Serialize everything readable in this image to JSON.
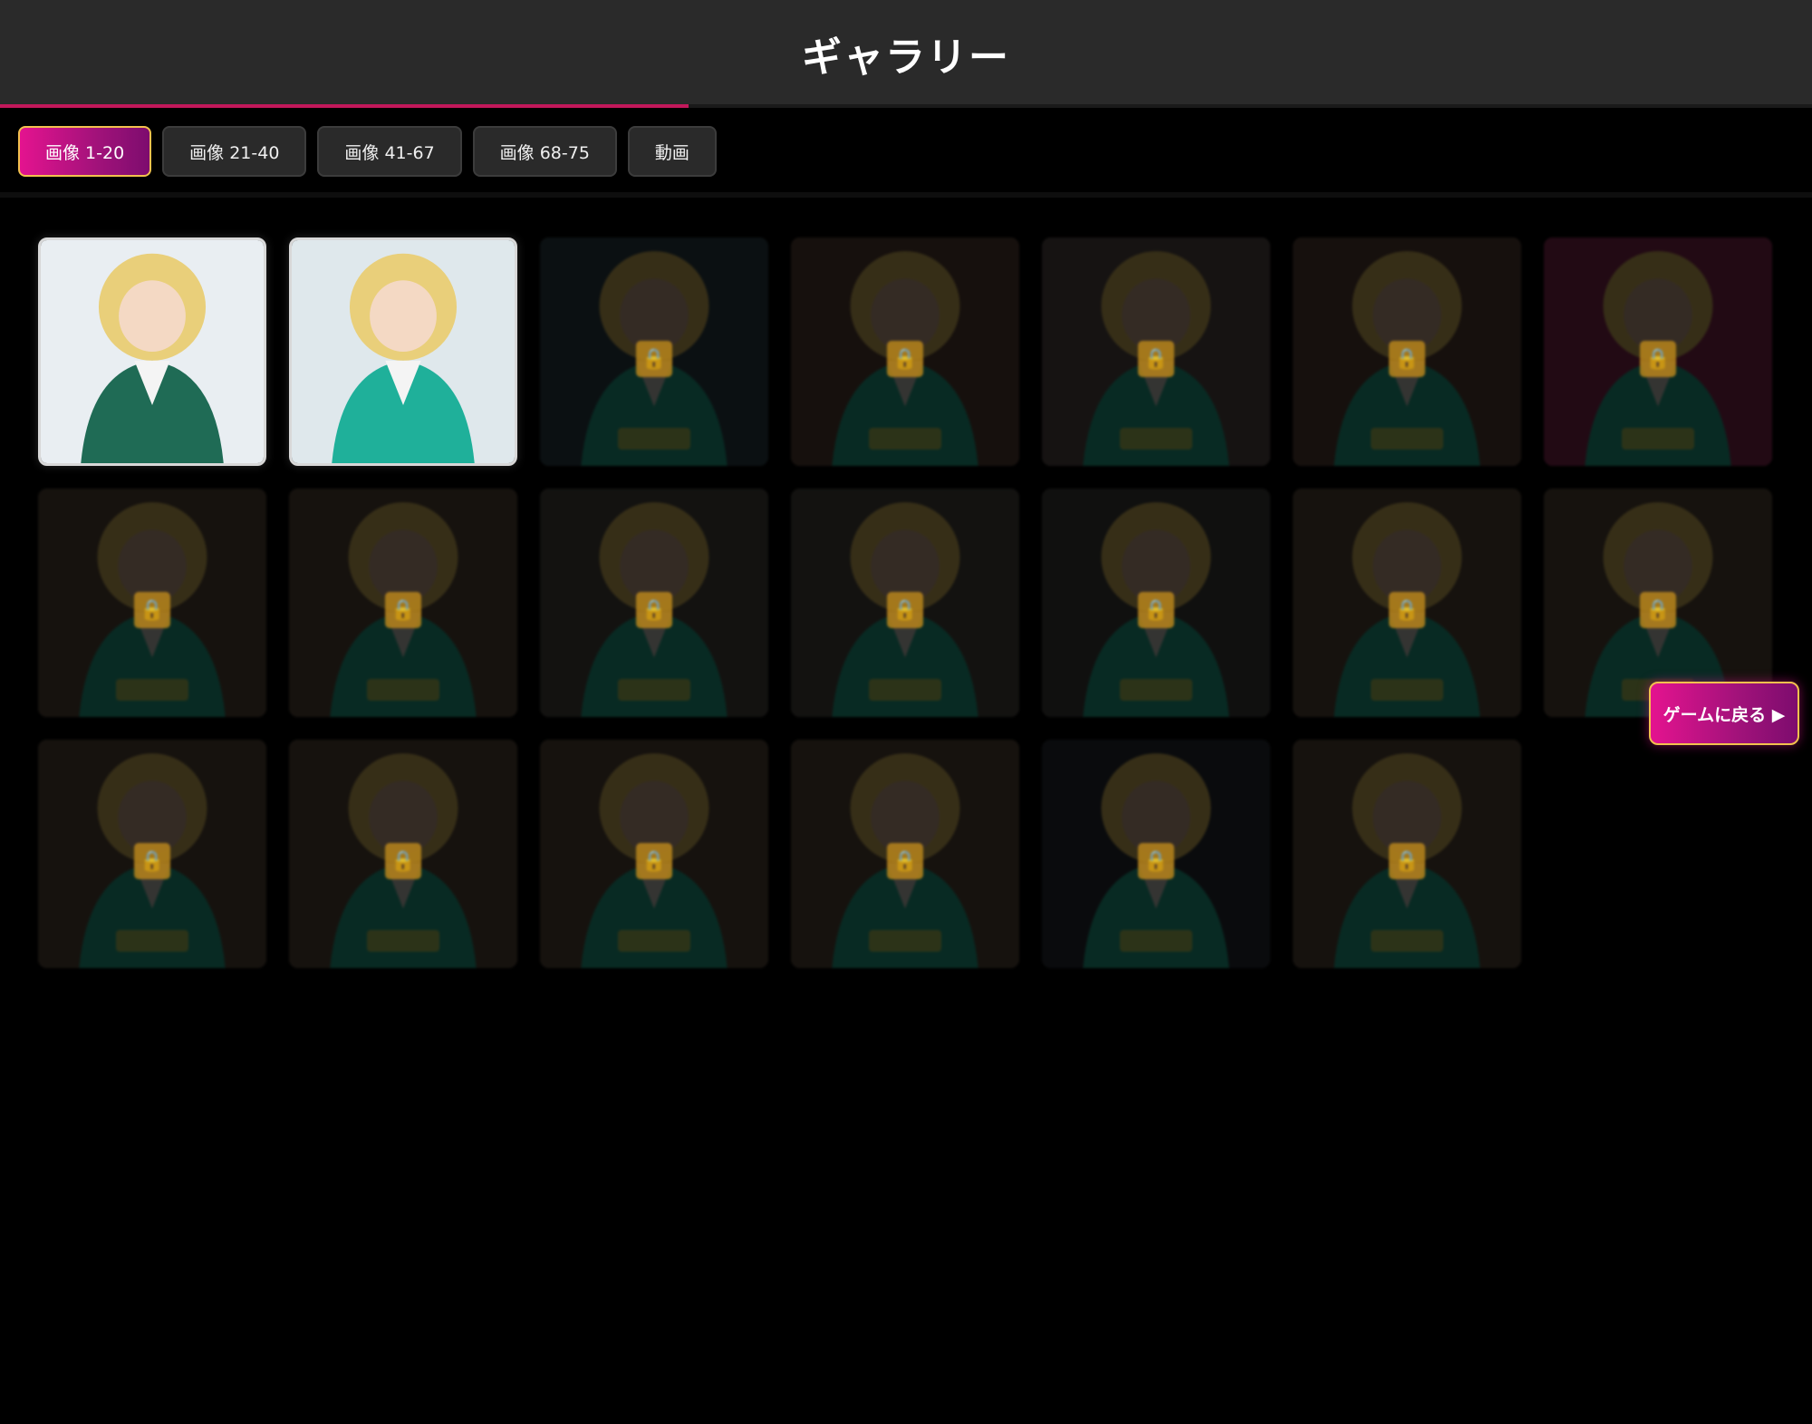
{
  "header": {
    "title": "ギャラリー",
    "unlock_progress": 0.38
  },
  "tabs": [
    {
      "label": "画像 1-20",
      "active": true
    },
    {
      "label": "画像 21-40",
      "active": false
    },
    {
      "label": "画像 41-67",
      "active": false
    },
    {
      "label": "画像 68-75",
      "active": false
    },
    {
      "label": "動画",
      "active": false
    }
  ],
  "gallery": {
    "items": [
      {
        "state": "unlocked",
        "bg": "#e9eef2",
        "vest": "#1f6b55"
      },
      {
        "state": "unlocked",
        "bg": "#dfe8ec",
        "vest": "#1fb09a"
      },
      {
        "state": "locked",
        "bg": "#1e2a30",
        "vest": "#17705c"
      },
      {
        "state": "locked",
        "bg": "#3a2a22",
        "vest": "#17705c"
      },
      {
        "state": "locked",
        "bg": "#3a3430",
        "vest": "#17705c"
      },
      {
        "state": "locked",
        "bg": "#3a2b24",
        "vest": "#17705c"
      },
      {
        "state": "locked",
        "bg": "#5a1c36",
        "vest": "#17705c"
      },
      {
        "state": "locked",
        "bg": "#3a3026",
        "vest": "#17705c"
      },
      {
        "state": "locked",
        "bg": "#3a3026",
        "vest": "#17705c"
      },
      {
        "state": "locked",
        "bg": "#33302c",
        "vest": "#17705c"
      },
      {
        "state": "locked",
        "bg": "#33302c",
        "vest": "#17705c"
      },
      {
        "state": "locked",
        "bg": "#2b2a28",
        "vest": "#17705c"
      },
      {
        "state": "locked",
        "bg": "#3a3026",
        "vest": "#17705c"
      },
      {
        "state": "locked",
        "bg": "#3a3026",
        "vest": "#17705c"
      },
      {
        "state": "locked",
        "bg": "#3a3026",
        "vest": "#17705c"
      },
      {
        "state": "locked",
        "bg": "#3a3026",
        "vest": "#17705c"
      },
      {
        "state": "locked",
        "bg": "#3a3026",
        "vest": "#17705c"
      },
      {
        "state": "locked",
        "bg": "#3a3026",
        "vest": "#17705c"
      },
      {
        "state": "locked",
        "bg": "#1c1f22",
        "vest": "#17705c"
      },
      {
        "state": "locked",
        "bg": "#3a3026",
        "vest": "#17705c"
      }
    ]
  },
  "return_button": {
    "label": "ゲームに戻る ▶"
  },
  "colors": {
    "accent": "#e4138f",
    "accent_border": "#f2c14e",
    "header_bg": "#2a2a2a",
    "page_bg": "#000000"
  }
}
